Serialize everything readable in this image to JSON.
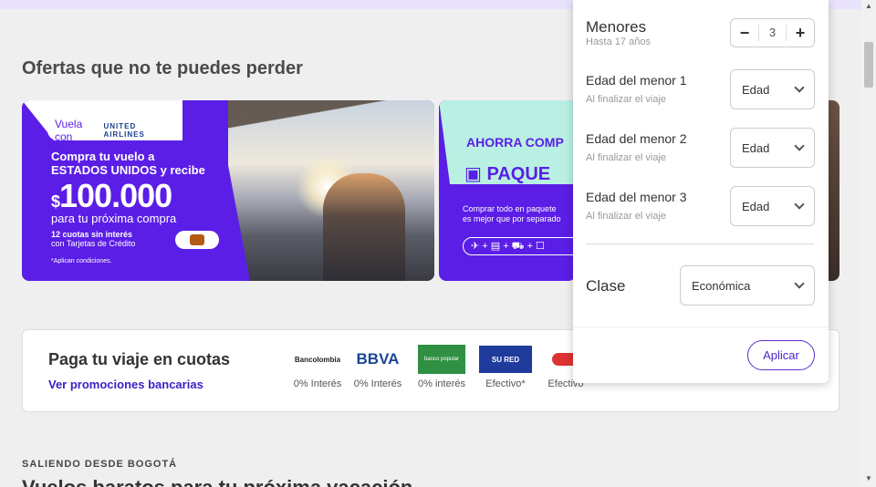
{
  "offers": {
    "title": "Ofertas que no te puedes perder",
    "banner1": {
      "tag_prefix": "Vuela con",
      "airline": "UNITED AIRLINES",
      "line1": "Compra tu vuelo a",
      "line2": "ESTADOS UNIDOS y recibe",
      "currency": "$",
      "amount": "100.000",
      "next": "para tu próxima compra",
      "cuotas_bold": "12 cuotas sin interés",
      "cuotas_rest": "con Tarjetas de Crédito",
      "conditions": "*Aplican condiciones."
    },
    "banner2": {
      "headline": "AHORRA COMP",
      "product": "PAQUE",
      "body_line1": "Comprar todo en paquete",
      "body_line2": "es mejor que por separado",
      "icons_text": "✈ + ▤ + ⛟ + ☐"
    }
  },
  "payments": {
    "title": "Paga tu viaje en cuotas",
    "link": "Ver promociones bancarias",
    "banks": [
      {
        "name": "Bancolombia",
        "caption": "0% Interés"
      },
      {
        "name": "BBVA",
        "caption": "0% Interés"
      },
      {
        "name": "banco popular",
        "caption": "0% interés"
      },
      {
        "name": "SU RED",
        "caption": "Efectivo*"
      },
      {
        "name": "",
        "caption": "Efectivo"
      }
    ]
  },
  "departing": {
    "label": "SALIENDO DESDE BOGOTÁ",
    "heading": "Vuelos baratos para tu próxima vacación"
  },
  "panel": {
    "minors": {
      "label": "Menores",
      "sub": "Hasta 17 años",
      "value": "3",
      "minus": "−",
      "plus": "+"
    },
    "ages": [
      {
        "label": "Edad del menor 1",
        "sub": "Al finalizar el viaje",
        "value": "Edad"
      },
      {
        "label": "Edad del menor 2",
        "sub": "Al finalizar el viaje",
        "value": "Edad"
      },
      {
        "label": "Edad del menor 3",
        "sub": "Al finalizar el viaje",
        "value": "Edad"
      }
    ],
    "clase": {
      "label": "Clase",
      "value": "Económica"
    },
    "apply": "Aplicar"
  },
  "scrollbar": {
    "up": "▲",
    "down": "▼"
  }
}
